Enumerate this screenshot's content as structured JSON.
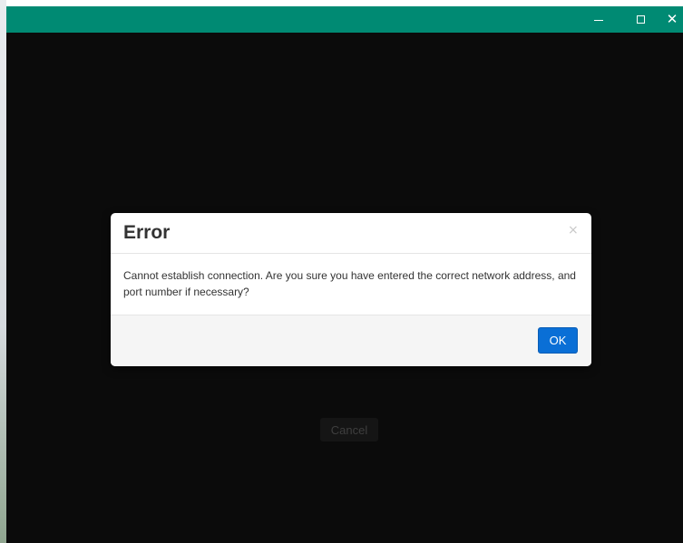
{
  "window": {
    "background": "#0b0b0b",
    "titlebar_color": "#008a73",
    "controls": {
      "minimize": "minimize-icon",
      "maximize": "maximize-icon",
      "close": "close-icon"
    }
  },
  "background_button": {
    "label": "Cancel"
  },
  "dialog": {
    "title": "Error",
    "close_glyph": "×",
    "message": "Cannot establish connection. Are you sure you have entered the correct network address, and port number if necessary?",
    "ok_label": "OK",
    "ok_color": "#0a6fd6"
  }
}
